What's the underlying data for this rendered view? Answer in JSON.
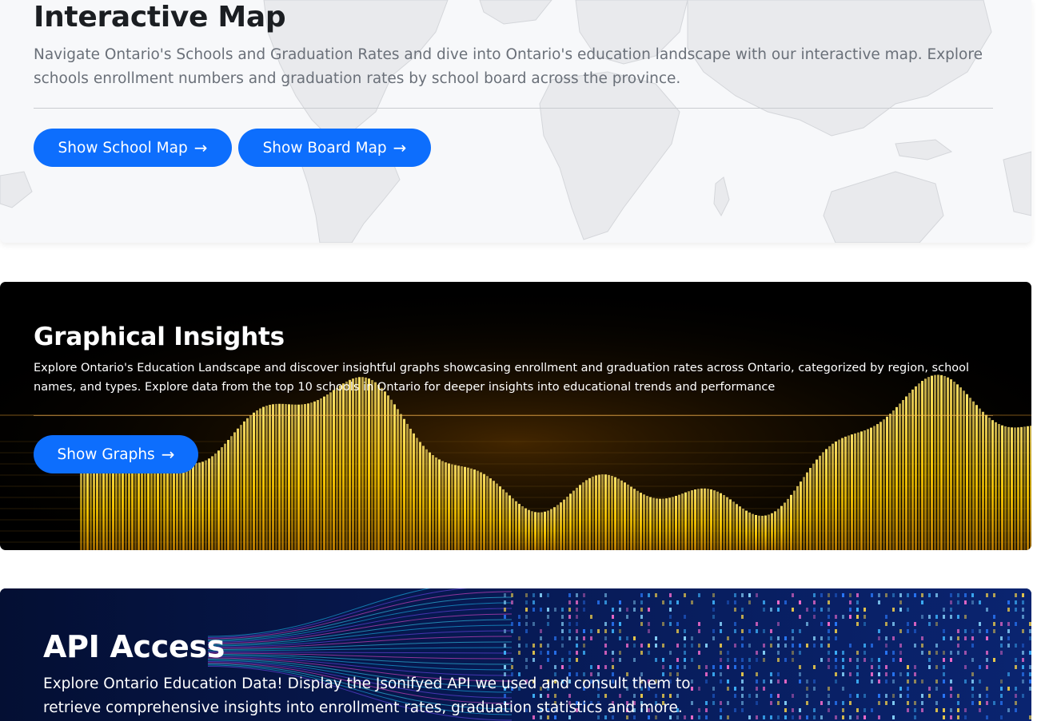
{
  "map_section": {
    "title": "Interactive Map",
    "description": "Navigate Ontario's Schools and Graduation Rates and dive into Ontario's education landscape with our interactive map. Explore schools enrollment numbers and graduation rates by school board across the province.",
    "buttons": [
      {
        "label": "Show School Map",
        "icon": "arrow-right-icon"
      },
      {
        "label": "Show Board Map",
        "icon": "arrow-right-icon"
      }
    ]
  },
  "graph_section": {
    "title": "Graphical Insights",
    "description": "Explore Ontario's Education Landscape and discover insightful graphs showcasing enrollment and graduation rates across Ontario, categorized by region, school names, and types. Explore data from the top 10 schools in Ontario for deeper insights into educational trends and performance",
    "button": {
      "label": "Show Graphs",
      "icon": "arrow-right-icon"
    }
  },
  "api_section": {
    "title": "API Access",
    "description": "Explore Ontario Education Data! Display the Jsonifyed API we used and consult them to retrieve comprehensive insights into enrollment rates, graduation statistics and more."
  },
  "arrow_glyph": "→",
  "colors": {
    "button_blue": "#0d6efd",
    "map_background": "#f7f8fa",
    "graph_background": "#000000",
    "graph_accent": "#f5c400",
    "api_background": "#04123d"
  }
}
